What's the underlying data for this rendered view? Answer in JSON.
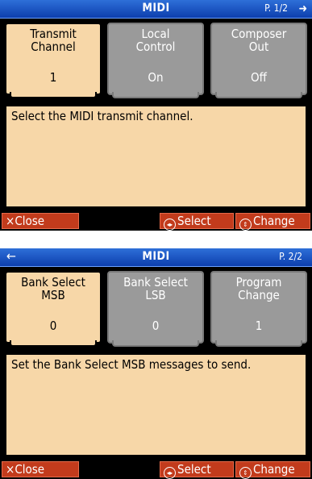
{
  "screens": [
    {
      "title": "MIDI",
      "page": "P. 1/2",
      "nav_icon": "arrow-right-icon",
      "cards": [
        {
          "label": "Transmit\nChannel",
          "value": "1",
          "selected": true
        },
        {
          "label": "Local\nControl",
          "value": "On",
          "selected": false
        },
        {
          "label": "Composer\nOut",
          "value": "Off",
          "selected": false
        }
      ],
      "description": "Select the MIDI transmit channel.",
      "buttons": {
        "close": "Close",
        "select": "Select",
        "change": "Change"
      }
    },
    {
      "title": "MIDI",
      "page": "P. 2/2",
      "nav_icon": "arrow-left-icon",
      "cards": [
        {
          "label": "Bank Select\nMSB",
          "value": "0",
          "selected": true
        },
        {
          "label": "Bank Select\nLSB",
          "value": "0",
          "selected": false
        },
        {
          "label": "Program\nChange",
          "value": "1",
          "selected": false
        }
      ],
      "description": "Set the Bank Select MSB messages to send.",
      "buttons": {
        "close": "Close",
        "select": "Select",
        "change": "Change"
      }
    }
  ],
  "colors": {
    "title_bar": "#1e57c8",
    "card_selected": "#f7d7a8",
    "card_unselected": "#9a9a9a",
    "button": "#c23b1c"
  }
}
